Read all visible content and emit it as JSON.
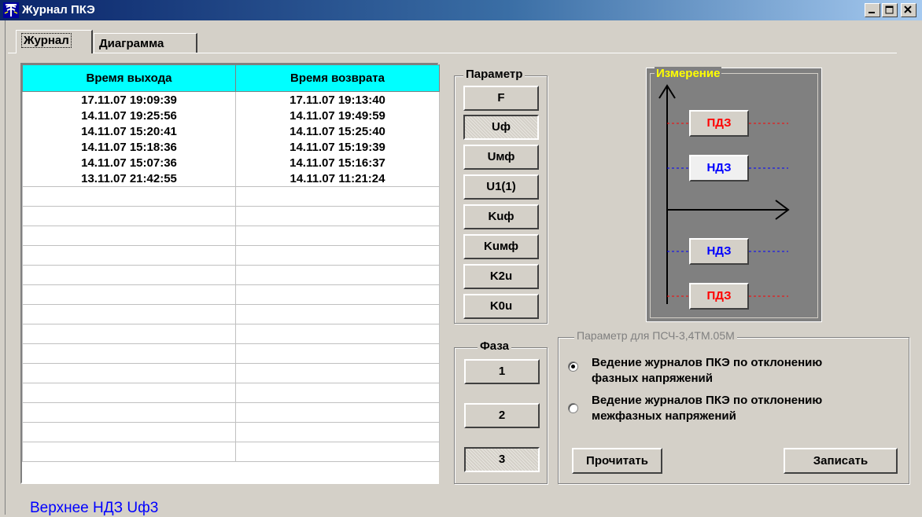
{
  "window": {
    "title": "Журнал ПКЭ"
  },
  "tabs": [
    {
      "label": "Журнал",
      "active": true
    },
    {
      "label": "Диаграмма",
      "active": false
    }
  ],
  "journal": {
    "columns": [
      "Время выхода",
      "Время возврата"
    ],
    "rows": [
      [
        "17.11.07 19:09:39",
        "17.11.07 19:13:40"
      ],
      [
        "14.11.07 19:25:56",
        "14.11.07 19:49:59"
      ],
      [
        "14.11.07 15:20:41",
        "14.11.07 15:25:40"
      ],
      [
        "14.11.07 15:18:36",
        "14.11.07 15:19:39"
      ],
      [
        "14.11.07 15:07:36",
        "14.11.07 15:16:37"
      ],
      [
        "13.11.07 21:42:55",
        "14.11.07 11:21:24"
      ]
    ]
  },
  "parameter": {
    "label": "Параметр",
    "buttons": [
      "F",
      "Uф",
      "Uмф",
      "U1(1)",
      "Kuф",
      "Kuмф",
      "K2u",
      "K0u"
    ],
    "selected": "Uф"
  },
  "phase": {
    "label": "Фаза",
    "buttons": [
      "1",
      "2",
      "3"
    ],
    "selected": "3"
  },
  "measurement": {
    "label": "Измерение",
    "buttons": [
      {
        "label": "ПДЗ",
        "color": "#ff0000"
      },
      {
        "label": "НДЗ",
        "color": "#0000ff"
      },
      {
        "label": "НДЗ",
        "color": "#0000ff"
      },
      {
        "label": "ПДЗ",
        "color": "#ff0000"
      }
    ]
  },
  "psch": {
    "label": "Параметр для ПСЧ-3,4ТМ.05М",
    "options": [
      {
        "line1": "Ведение журналов ПКЭ по отклонению",
        "line2": "фазных напряжений",
        "checked": true
      },
      {
        "line1": "Ведение журналов ПКЭ по отклонению",
        "line2": "межфазных напряжений",
        "checked": false
      }
    ],
    "read_label": "Прочитать",
    "write_label": "Записать"
  },
  "status": "Верхнее НДЗ Uф3"
}
